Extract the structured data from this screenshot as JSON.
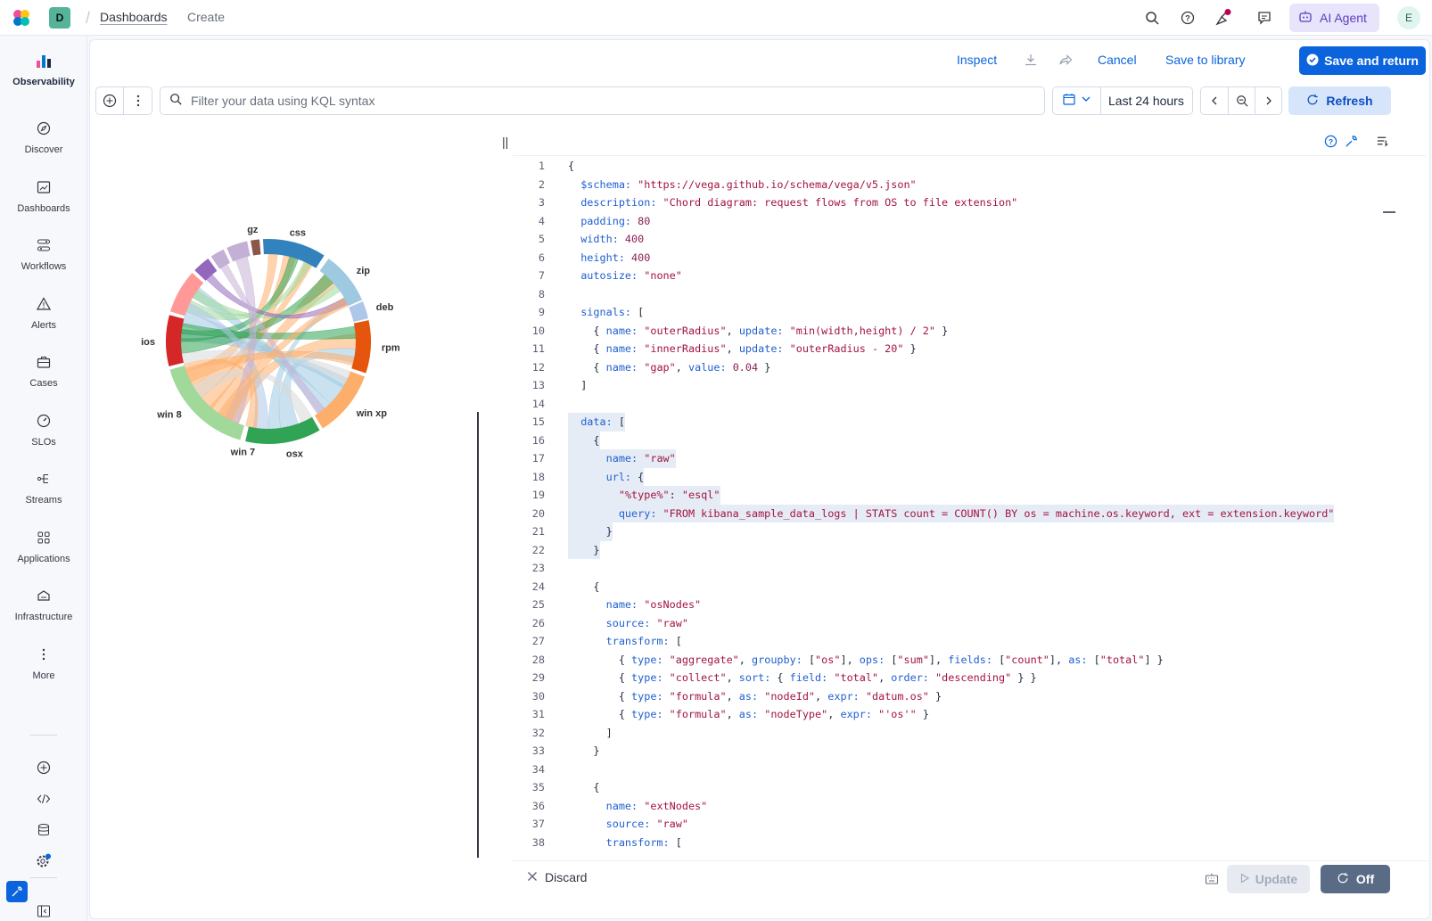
{
  "topbar": {
    "space_initial": "D",
    "breadcrumbs": [
      "Dashboards",
      "Create"
    ],
    "ai_agent_label": "AI Agent",
    "user_initial": "E",
    "icons": [
      "search-icon",
      "help-icon",
      "news-feed-icon",
      "chat-icon"
    ]
  },
  "sidenav": {
    "items": [
      {
        "label": "Observability",
        "icon": "observability-icon"
      },
      {
        "label": "Discover",
        "icon": "compass-icon"
      },
      {
        "label": "Dashboards",
        "icon": "dashboard-icon"
      },
      {
        "label": "Workflows",
        "icon": "workflows-icon"
      },
      {
        "label": "Alerts",
        "icon": "alert-icon"
      },
      {
        "label": "Cases",
        "icon": "briefcase-icon"
      },
      {
        "label": "SLOs",
        "icon": "gauge-icon"
      },
      {
        "label": "Streams",
        "icon": "streams-icon"
      },
      {
        "label": "Applications",
        "icon": "apps-grid-icon"
      },
      {
        "label": "Infrastructure",
        "icon": "infrastructure-icon"
      },
      {
        "label": "More",
        "icon": "more-icon"
      }
    ],
    "bottom_icons": [
      "add-icon",
      "code-icon",
      "database-icon",
      "settings-icon",
      "collapse-icon"
    ]
  },
  "actions": {
    "inspect": "Inspect",
    "cancel": "Cancel",
    "save_library": "Save to library",
    "save_return": "Save and return"
  },
  "query": {
    "placeholder": "Filter your data using KQL syntax",
    "time_range": "Last 24 hours",
    "refresh": "Refresh"
  },
  "chart": {
    "os_nodes": [
      "win 8",
      "win 7",
      "osx",
      "win xp",
      "ios"
    ],
    "ext_nodes": [
      "gz",
      "css",
      "zip",
      "deb",
      "rpm"
    ],
    "colors": {
      "win 8": "#a1d99b",
      "win 7": "#4aa145",
      "osx": "#31a354",
      "win xp": "#fdae6b",
      "rpm": "#e6550d",
      "deb": "#9ecae1",
      "zip": "#9ecae1",
      "css": "#3182bd",
      "gz": "#8c564b",
      "ios": "#d62728"
    }
  },
  "editor": {
    "lines": [
      [
        {
          "t": "{",
          "c": ""
        }
      ],
      [
        {
          "t": "  $schema: ",
          "c": "k"
        },
        {
          "t": "\"https://vega.github.io/schema/vega/v5.json\"",
          "c": "s"
        }
      ],
      [
        {
          "t": "  description: ",
          "c": "k"
        },
        {
          "t": "\"Chord diagram: request flows from OS to file extension\"",
          "c": "s"
        }
      ],
      [
        {
          "t": "  padding: ",
          "c": "k"
        },
        {
          "t": "80",
          "c": "n"
        }
      ],
      [
        {
          "t": "  width: ",
          "c": "k"
        },
        {
          "t": "400",
          "c": "n"
        }
      ],
      [
        {
          "t": "  height: ",
          "c": "k"
        },
        {
          "t": "400",
          "c": "n"
        }
      ],
      [
        {
          "t": "  autosize: ",
          "c": "k"
        },
        {
          "t": "\"none\"",
          "c": "s"
        }
      ],
      [
        {
          "t": "",
          "c": ""
        }
      ],
      [
        {
          "t": "  signals: ",
          "c": "k"
        },
        {
          "t": "[",
          "c": ""
        }
      ],
      [
        {
          "t": "    { ",
          "c": ""
        },
        {
          "t": "name: ",
          "c": "k"
        },
        {
          "t": "\"outerRadius\"",
          "c": "s"
        },
        {
          "t": ", ",
          "c": ""
        },
        {
          "t": "update: ",
          "c": "k"
        },
        {
          "t": "\"min(width,height) / 2\"",
          "c": "s"
        },
        {
          "t": " }",
          "c": ""
        }
      ],
      [
        {
          "t": "    { ",
          "c": ""
        },
        {
          "t": "name: ",
          "c": "k"
        },
        {
          "t": "\"innerRadius\"",
          "c": "s"
        },
        {
          "t": ", ",
          "c": ""
        },
        {
          "t": "update: ",
          "c": "k"
        },
        {
          "t": "\"outerRadius - 20\"",
          "c": "s"
        },
        {
          "t": " }",
          "c": ""
        }
      ],
      [
        {
          "t": "    { ",
          "c": ""
        },
        {
          "t": "name: ",
          "c": "k"
        },
        {
          "t": "\"gap\"",
          "c": "s"
        },
        {
          "t": ", ",
          "c": ""
        },
        {
          "t": "value: ",
          "c": "k"
        },
        {
          "t": "0.04",
          "c": "n"
        },
        {
          "t": " }",
          "c": ""
        }
      ],
      [
        {
          "t": "  ]",
          "c": ""
        }
      ],
      [
        {
          "t": "",
          "c": ""
        }
      ],
      [
        {
          "t": "  data: ",
          "c": "k"
        },
        {
          "t": "[",
          "c": ""
        }
      ],
      [
        {
          "t": "    {",
          "c": ""
        }
      ],
      [
        {
          "t": "      name: ",
          "c": "k"
        },
        {
          "t": "\"raw\"",
          "c": "s"
        }
      ],
      [
        {
          "t": "      url: ",
          "c": "k"
        },
        {
          "t": "{",
          "c": ""
        }
      ],
      [
        {
          "t": "        ",
          "c": ""
        },
        {
          "t": "\"%type%\"",
          "c": "s"
        },
        {
          "t": ": ",
          "c": ""
        },
        {
          "t": "\"esql\"",
          "c": "s"
        }
      ],
      [
        {
          "t": "        query: ",
          "c": "k"
        },
        {
          "t": "\"FROM kibana_sample_data_logs | STATS count = COUNT() BY os = machine.os.keyword, ext = extension.keyword\"",
          "c": "s"
        }
      ],
      [
        {
          "t": "      }",
          "c": ""
        }
      ],
      [
        {
          "t": "    }",
          "c": ""
        }
      ],
      [
        {
          "t": "",
          "c": ""
        }
      ],
      [
        {
          "t": "    {",
          "c": ""
        }
      ],
      [
        {
          "t": "      name: ",
          "c": "k"
        },
        {
          "t": "\"osNodes\"",
          "c": "s"
        }
      ],
      [
        {
          "t": "      source: ",
          "c": "k"
        },
        {
          "t": "\"raw\"",
          "c": "s"
        }
      ],
      [
        {
          "t": "      transform: ",
          "c": "k"
        },
        {
          "t": "[",
          "c": ""
        }
      ],
      [
        {
          "t": "        { ",
          "c": ""
        },
        {
          "t": "type: ",
          "c": "k"
        },
        {
          "t": "\"aggregate\"",
          "c": "s"
        },
        {
          "t": ", ",
          "c": ""
        },
        {
          "t": "groupby: ",
          "c": "k"
        },
        {
          "t": "[",
          "c": ""
        },
        {
          "t": "\"os\"",
          "c": "s"
        },
        {
          "t": "], ",
          "c": ""
        },
        {
          "t": "ops: ",
          "c": "k"
        },
        {
          "t": "[",
          "c": ""
        },
        {
          "t": "\"sum\"",
          "c": "s"
        },
        {
          "t": "], ",
          "c": ""
        },
        {
          "t": "fields: ",
          "c": "k"
        },
        {
          "t": "[",
          "c": ""
        },
        {
          "t": "\"count\"",
          "c": "s"
        },
        {
          "t": "], ",
          "c": ""
        },
        {
          "t": "as: ",
          "c": "k"
        },
        {
          "t": "[",
          "c": ""
        },
        {
          "t": "\"total\"",
          "c": "s"
        },
        {
          "t": "] }",
          "c": ""
        }
      ],
      [
        {
          "t": "        { ",
          "c": ""
        },
        {
          "t": "type: ",
          "c": "k"
        },
        {
          "t": "\"collect\"",
          "c": "s"
        },
        {
          "t": ", ",
          "c": ""
        },
        {
          "t": "sort: ",
          "c": "k"
        },
        {
          "t": "{ ",
          "c": ""
        },
        {
          "t": "field: ",
          "c": "k"
        },
        {
          "t": "\"total\"",
          "c": "s"
        },
        {
          "t": ", ",
          "c": ""
        },
        {
          "t": "order: ",
          "c": "k"
        },
        {
          "t": "\"descending\"",
          "c": "s"
        },
        {
          "t": " } }",
          "c": ""
        }
      ],
      [
        {
          "t": "        { ",
          "c": ""
        },
        {
          "t": "type: ",
          "c": "k"
        },
        {
          "t": "\"formula\"",
          "c": "s"
        },
        {
          "t": ", ",
          "c": ""
        },
        {
          "t": "as: ",
          "c": "k"
        },
        {
          "t": "\"nodeId\"",
          "c": "s"
        },
        {
          "t": ", ",
          "c": ""
        },
        {
          "t": "expr: ",
          "c": "k"
        },
        {
          "t": "\"datum.os\"",
          "c": "s"
        },
        {
          "t": " }",
          "c": ""
        }
      ],
      [
        {
          "t": "        { ",
          "c": ""
        },
        {
          "t": "type: ",
          "c": "k"
        },
        {
          "t": "\"formula\"",
          "c": "s"
        },
        {
          "t": ", ",
          "c": ""
        },
        {
          "t": "as: ",
          "c": "k"
        },
        {
          "t": "\"nodeType\"",
          "c": "s"
        },
        {
          "t": ", ",
          "c": ""
        },
        {
          "t": "expr: ",
          "c": "k"
        },
        {
          "t": "\"'os'\"",
          "c": "s"
        },
        {
          "t": " }",
          "c": ""
        }
      ],
      [
        {
          "t": "      ]",
          "c": ""
        }
      ],
      [
        {
          "t": "    }",
          "c": ""
        }
      ],
      [
        {
          "t": "",
          "c": ""
        }
      ],
      [
        {
          "t": "    {",
          "c": ""
        }
      ],
      [
        {
          "t": "      name: ",
          "c": "k"
        },
        {
          "t": "\"extNodes\"",
          "c": "s"
        }
      ],
      [
        {
          "t": "      source: ",
          "c": "k"
        },
        {
          "t": "\"raw\"",
          "c": "s"
        }
      ],
      [
        {
          "t": "      transform: ",
          "c": "k"
        },
        {
          "t": "[",
          "c": ""
        }
      ]
    ],
    "highlight_from": 15,
    "highlight_to": 22
  },
  "bottombar": {
    "discard": "Discard",
    "update": "Update",
    "off": "Off"
  }
}
